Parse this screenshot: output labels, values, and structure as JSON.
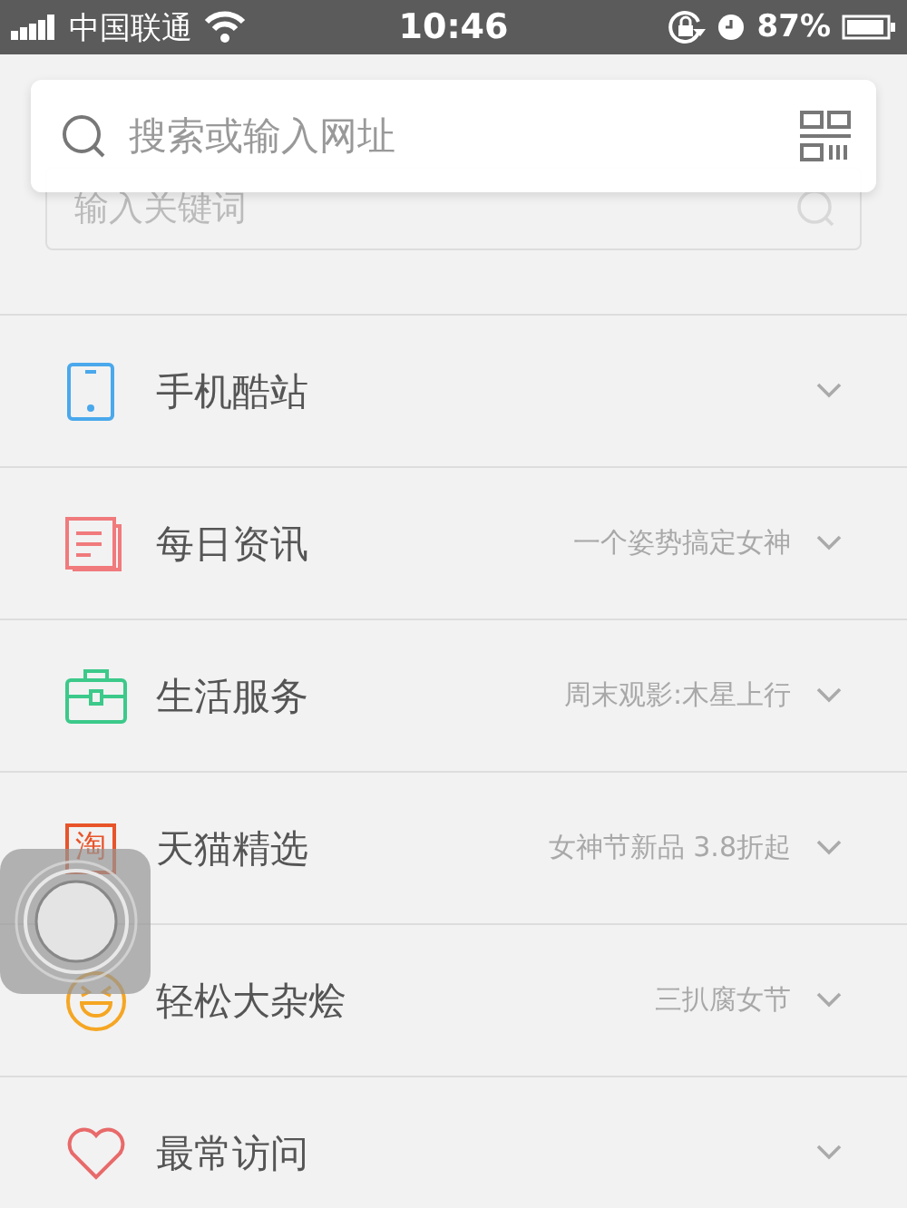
{
  "status_bar": {
    "carrier": "中国联通",
    "time": "10:46",
    "battery": "87%"
  },
  "search_bar": {
    "placeholder": "搜索或输入网址"
  },
  "keyword_field": {
    "placeholder": "输入关键词"
  },
  "sections": [
    {
      "kind": "phone",
      "color": "#4aa8ec",
      "title": "手机酷站"
    },
    {
      "kind": "news",
      "color": "#f07a7c",
      "title": "每日资讯",
      "subtitle": "一个姿势搞定女神"
    },
    {
      "kind": "briefcase",
      "color": "#3cc98a",
      "title": "生活服务",
      "subtitle": "周末观影:木星上行"
    },
    {
      "kind": "glyph",
      "color": "#e8542a",
      "glyph": "淘",
      "title": "天猫精选",
      "subtitle": "女神节新品 3.8折起"
    },
    {
      "kind": "smiley",
      "color": "#f5a623",
      "title": "轻松大杂烩",
      "subtitle": "三扒腐女节"
    },
    {
      "kind": "heart",
      "color": "#e86a6a",
      "title": "最常访问"
    }
  ]
}
